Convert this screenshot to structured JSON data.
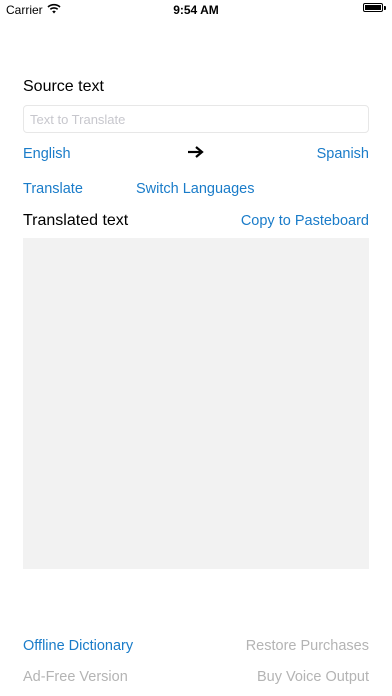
{
  "status_bar": {
    "carrier": "Carrier",
    "time": "9:54 AM",
    "battery_level": 1.0
  },
  "source": {
    "label": "Source text",
    "input_placeholder": "Text to Translate",
    "input_value": ""
  },
  "languages": {
    "from": "English",
    "arrow_icon": "arrow-right-icon",
    "to": "Spanish"
  },
  "actions": {
    "translate": "Translate",
    "switch": "Switch Languages"
  },
  "translated": {
    "label": "Translated text",
    "copy": "Copy to Pasteboard",
    "text": ""
  },
  "footer": {
    "offline_dictionary": "Offline Dictionary",
    "restore_purchases": "Restore Purchases",
    "ad_free": "Ad-Free Version",
    "buy_voice": "Buy Voice Output"
  },
  "colors": {
    "link": "#1a7cc9",
    "disabled": "#b4b4b4",
    "output_background": "#f2f2f2"
  }
}
